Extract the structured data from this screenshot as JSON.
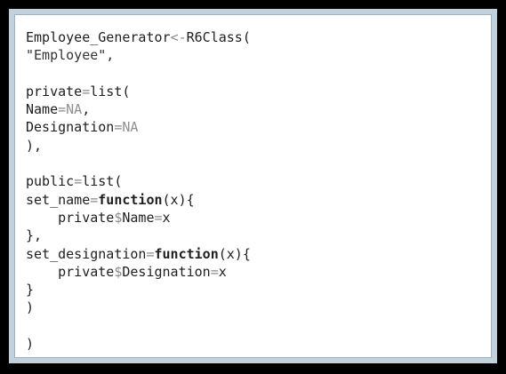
{
  "code_lines": [
    [
      {
        "t": "Employee_Generator",
        "c": "plain"
      },
      {
        "t": "<-",
        "c": "op"
      },
      {
        "t": "R6Class(",
        "c": "plain"
      }
    ],
    [
      {
        "t": "\"Employee\",",
        "c": "str"
      }
    ],
    [],
    [
      {
        "t": "private",
        "c": "plain"
      },
      {
        "t": "=",
        "c": "op"
      },
      {
        "t": "list(",
        "c": "plain"
      }
    ],
    [
      {
        "t": "Name",
        "c": "plain"
      },
      {
        "t": "=",
        "c": "op"
      },
      {
        "t": "NA",
        "c": "na"
      },
      {
        "t": ",",
        "c": "plain"
      }
    ],
    [
      {
        "t": "Designation",
        "c": "plain"
      },
      {
        "t": "=",
        "c": "op"
      },
      {
        "t": "NA",
        "c": "na"
      }
    ],
    [
      {
        "t": "),",
        "c": "plain"
      }
    ],
    [],
    [
      {
        "t": "public",
        "c": "plain"
      },
      {
        "t": "=",
        "c": "op"
      },
      {
        "t": "list(",
        "c": "plain"
      }
    ],
    [
      {
        "t": "set_name",
        "c": "plain"
      },
      {
        "t": "=",
        "c": "op"
      },
      {
        "t": "function",
        "c": "kw"
      },
      {
        "t": "(x){",
        "c": "plain"
      }
    ],
    [
      {
        "t": "    private",
        "c": "plain"
      },
      {
        "t": "$",
        "c": "op"
      },
      {
        "t": "Name",
        "c": "plain"
      },
      {
        "t": "=",
        "c": "op"
      },
      {
        "t": "x",
        "c": "plain"
      }
    ],
    [
      {
        "t": "},",
        "c": "plain"
      }
    ],
    [
      {
        "t": "set_designation",
        "c": "plain"
      },
      {
        "t": "=",
        "c": "op"
      },
      {
        "t": "function",
        "c": "kw"
      },
      {
        "t": "(x){",
        "c": "plain"
      }
    ],
    [
      {
        "t": "    private",
        "c": "plain"
      },
      {
        "t": "$",
        "c": "op"
      },
      {
        "t": "Designation",
        "c": "plain"
      },
      {
        "t": "=",
        "c": "op"
      },
      {
        "t": "x",
        "c": "plain"
      }
    ],
    [
      {
        "t": "}",
        "c": "plain"
      }
    ],
    [
      {
        "t": ")",
        "c": "plain"
      }
    ],
    [],
    [
      {
        "t": ")",
        "c": "plain"
      }
    ]
  ],
  "colors": {
    "outer_background": "#000000",
    "frame": "#c3d1dc",
    "code_background": "#ffffff",
    "text": "#1e1e1e",
    "operator": "#8a8a8a",
    "na_literal": "#8f8f8f"
  }
}
